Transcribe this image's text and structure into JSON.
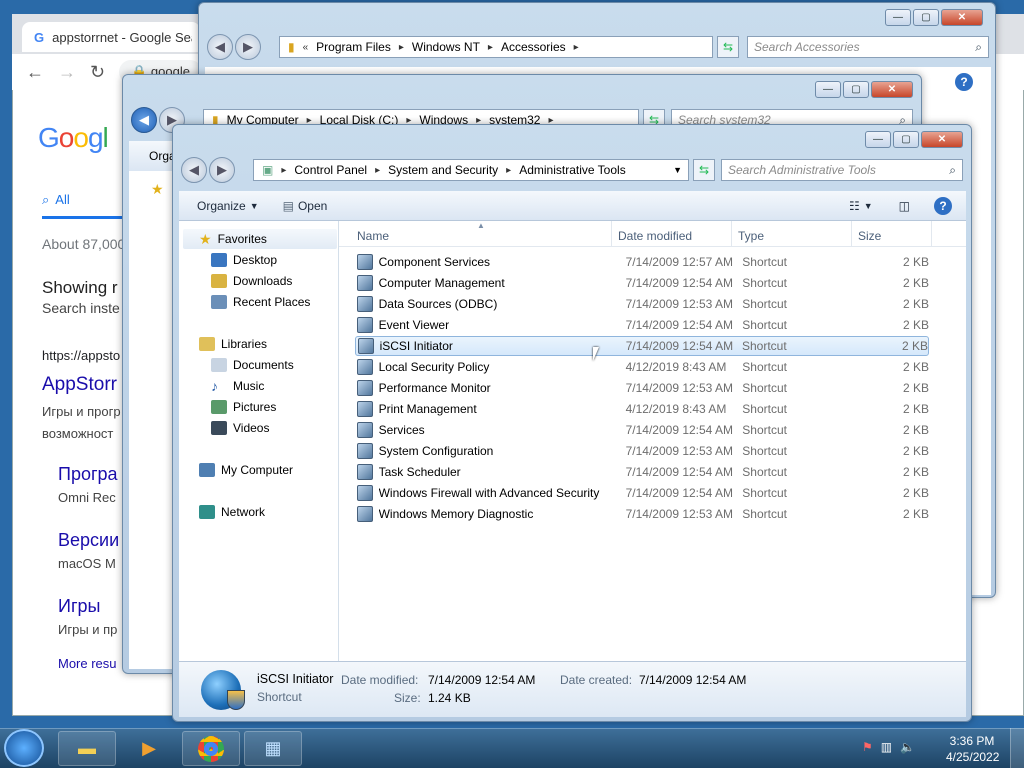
{
  "chrome": {
    "tab_title": "appstorrnet - Google Search",
    "address_partial": "google",
    "result_count": "About 87,000",
    "showing": "Showing r",
    "search_instead": "Search inste",
    "result_url": "https://appsto",
    "result_title": "AppStorr",
    "result_snippet1": "Игры и прогр",
    "result_snippet2": "возможност",
    "link1": "Програ",
    "link1_sub": "Omni Rec",
    "link2": "Версии",
    "link2_sub": "macOS M",
    "link3": "Игры",
    "link3_sub": "Игры и пр",
    "more_results": "More resu",
    "tab_all": "All",
    "logo": "Google"
  },
  "win_accessories": {
    "address": [
      "Program Files",
      "Windows NT",
      "Accessories"
    ],
    "search_placeholder": "Search Accessories"
  },
  "win_system32": {
    "address": [
      "My Computer",
      "Local Disk (C:)",
      "Windows",
      "system32"
    ],
    "search_placeholder": "Search system32",
    "organize_partial": "Orga"
  },
  "main": {
    "address": [
      "Control Panel",
      "System and Security",
      "Administrative Tools"
    ],
    "search_placeholder": "Search Administrative Tools",
    "toolbar": {
      "organize": "Organize",
      "open": "Open"
    },
    "nav": {
      "favorites": "Favorites",
      "desktop": "Desktop",
      "downloads": "Downloads",
      "recent": "Recent Places",
      "libraries": "Libraries",
      "documents": "Documents",
      "music": "Music",
      "pictures": "Pictures",
      "videos": "Videos",
      "computer": "My Computer",
      "network": "Network"
    },
    "columns": {
      "name": "Name",
      "date": "Date modified",
      "type": "Type",
      "size": "Size"
    },
    "files": [
      {
        "name": "Component Services",
        "date": "7/14/2009 12:57 AM",
        "type": "Shortcut",
        "size": "2 KB"
      },
      {
        "name": "Computer Management",
        "date": "7/14/2009 12:54 AM",
        "type": "Shortcut",
        "size": "2 KB"
      },
      {
        "name": "Data Sources (ODBC)",
        "date": "7/14/2009 12:53 AM",
        "type": "Shortcut",
        "size": "2 KB"
      },
      {
        "name": "Event Viewer",
        "date": "7/14/2009 12:54 AM",
        "type": "Shortcut",
        "size": "2 KB"
      },
      {
        "name": "iSCSI Initiator",
        "date": "7/14/2009 12:54 AM",
        "type": "Shortcut",
        "size": "2 KB"
      },
      {
        "name": "Local Security Policy",
        "date": "4/12/2019 8:43 AM",
        "type": "Shortcut",
        "size": "2 KB"
      },
      {
        "name": "Performance Monitor",
        "date": "7/14/2009 12:53 AM",
        "type": "Shortcut",
        "size": "2 KB"
      },
      {
        "name": "Print Management",
        "date": "4/12/2019 8:43 AM",
        "type": "Shortcut",
        "size": "2 KB"
      },
      {
        "name": "Services",
        "date": "7/14/2009 12:54 AM",
        "type": "Shortcut",
        "size": "2 KB"
      },
      {
        "name": "System Configuration",
        "date": "7/14/2009 12:53 AM",
        "type": "Shortcut",
        "size": "2 KB"
      },
      {
        "name": "Task Scheduler",
        "date": "7/14/2009 12:54 AM",
        "type": "Shortcut",
        "size": "2 KB"
      },
      {
        "name": "Windows Firewall with Advanced Security",
        "date": "7/14/2009 12:54 AM",
        "type": "Shortcut",
        "size": "2 KB"
      },
      {
        "name": "Windows Memory Diagnostic",
        "date": "7/14/2009 12:53 AM",
        "type": "Shortcut",
        "size": "2 KB"
      }
    ],
    "selected_index": 4,
    "details": {
      "name": "iSCSI Initiator",
      "kind": "Shortcut",
      "date_modified_label": "Date modified:",
      "date_modified": "7/14/2009 12:54 AM",
      "date_created_label": "Date created:",
      "date_created": "7/14/2009 12:54 AM",
      "size_label": "Size:",
      "size": "1.24 KB"
    }
  },
  "taskbar": {
    "time": "3:36 PM",
    "date": "4/25/2022"
  }
}
